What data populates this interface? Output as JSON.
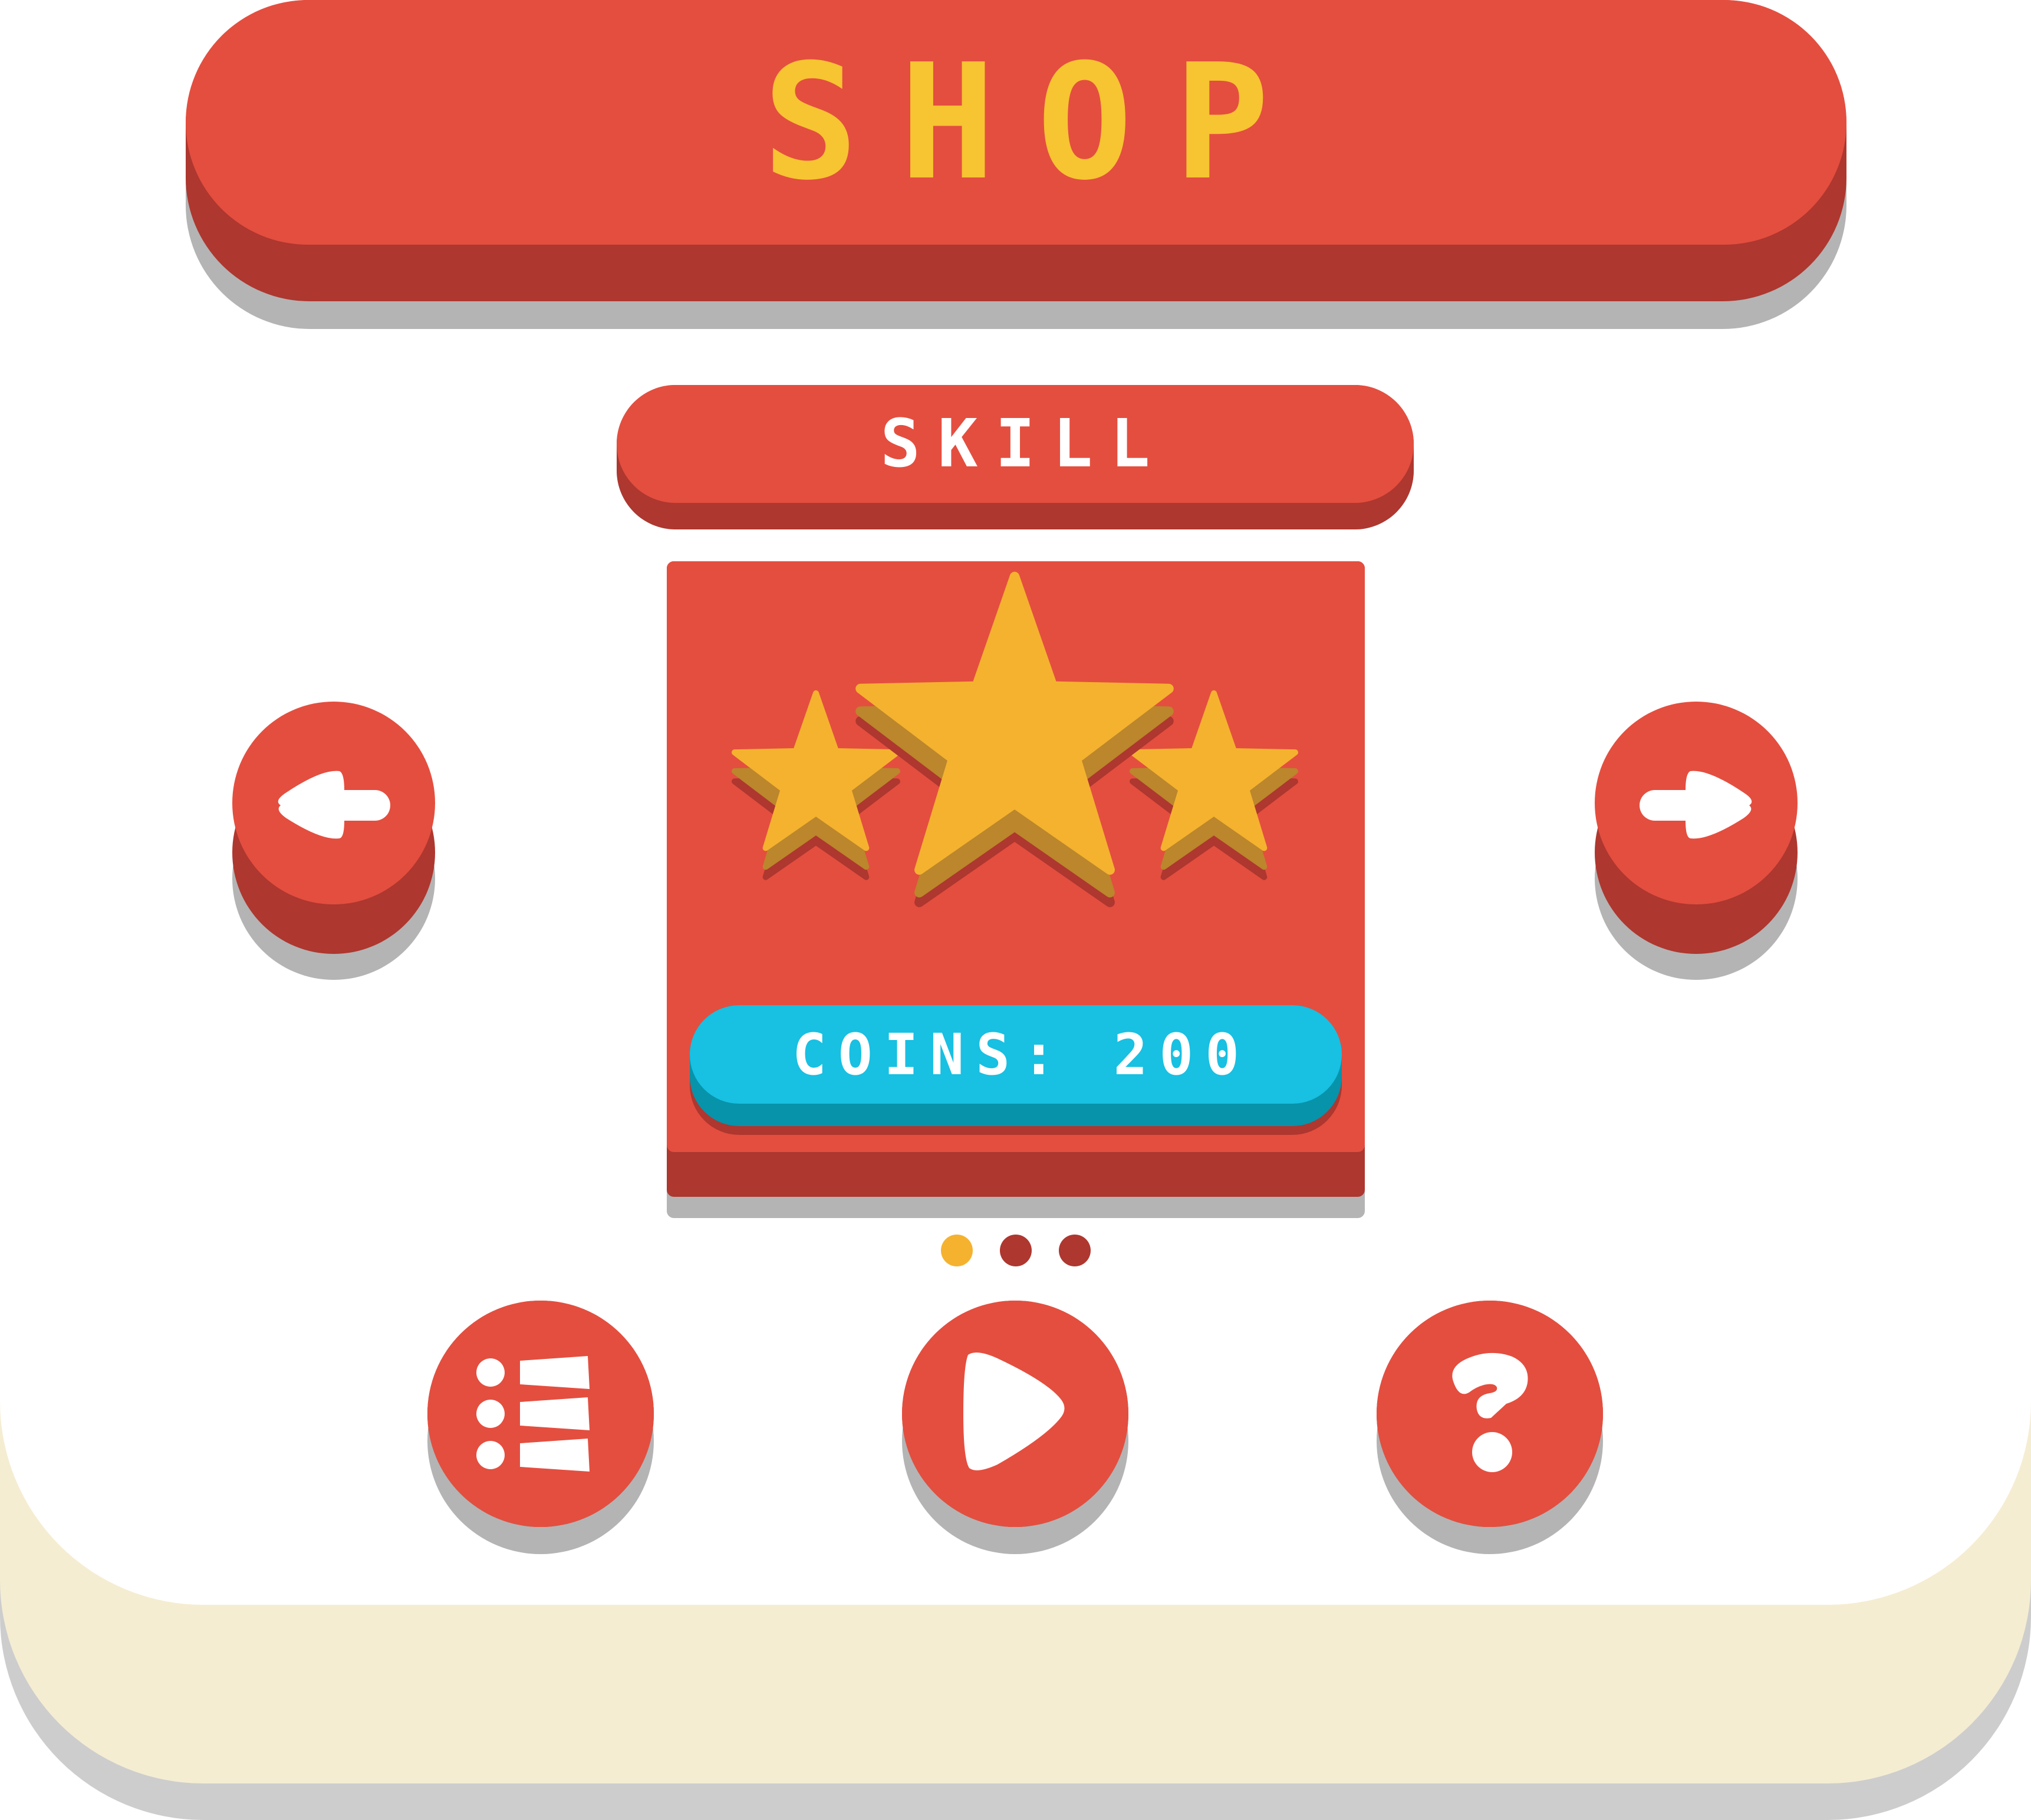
{
  "shop": {
    "title": "SHOP",
    "item": {
      "name": "SKILL",
      "icon": "three-stars-icon",
      "price_label": "COINS: 200"
    },
    "pager": {
      "page_count": 3,
      "active_page": 1
    },
    "nav": {
      "prev_icon": "arrow-left-icon",
      "next_icon": "arrow-right-icon"
    },
    "actions": [
      {
        "name": "menu-button",
        "icon": "list-icon"
      },
      {
        "name": "play-button",
        "icon": "play-icon"
      },
      {
        "name": "help-button",
        "icon": "question-mark-icon"
      }
    ]
  },
  "colors": {
    "primary_red": "#e44e3f",
    "dark_red": "#ae372f",
    "title_yellow": "#f7c432",
    "star_gold": "#f5b22f",
    "coins_blue": "#18c0e2",
    "panel_cream": "#f5edd2",
    "active_dot": "#f5b22f"
  }
}
